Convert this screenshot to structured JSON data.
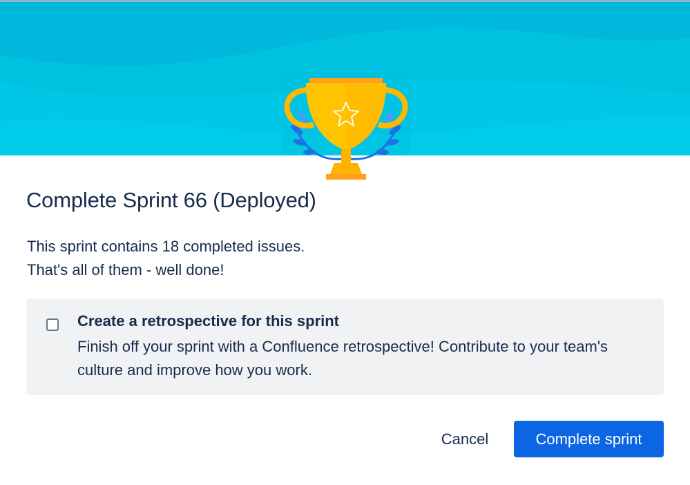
{
  "dialog": {
    "title": "Complete Sprint 66 (Deployed)",
    "description_line1": "This sprint contains 18 completed issues.",
    "description_line2": "That's all of them - well done!",
    "retrospective": {
      "checked": false,
      "title": "Create a retrospective for this sprint",
      "description": "Finish off your sprint with a Confluence retrospective! Contribute to your team's culture and improve how you work."
    },
    "buttons": {
      "cancel_label": "Cancel",
      "complete_label": "Complete sprint"
    }
  },
  "colors": {
    "header_background": "#00c2e0",
    "text_primary": "#172b4d",
    "panel_background": "#f1f2f4",
    "primary_button": "#0c66e4",
    "trophy_gold": "#ffc400",
    "trophy_accent": "#1f6fe5"
  },
  "icons": {
    "trophy": "trophy-icon",
    "star": "star-icon",
    "laurel": "laurel-icon"
  }
}
